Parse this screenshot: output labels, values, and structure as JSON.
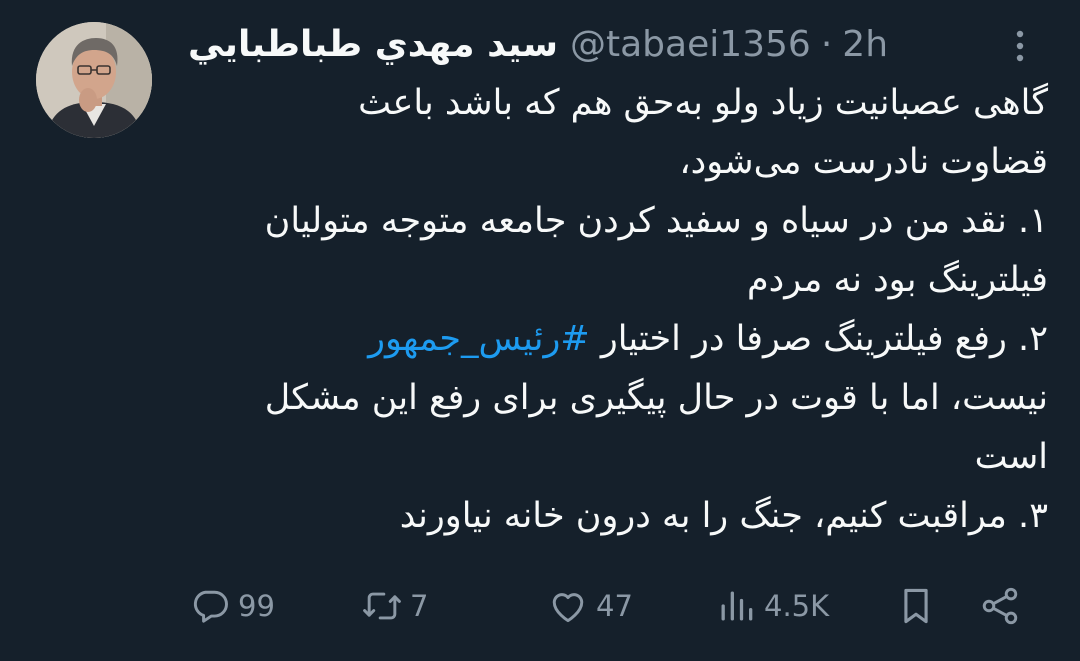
{
  "tweet": {
    "display_name": "سيد مهدي طباطبايي",
    "handle": "@tabaei1356",
    "separator": "·",
    "time": "2h",
    "avatar_icon": "profile-photo",
    "more_icon": "more-vertical-icon",
    "lines": [
      "گاهی عصبانیت زیاد ولو به‌حق هم که باشد باعث",
      "قضاوت نادرست می‌شود،",
      "۱. نقد من در سیاه و سفید کردن جامعه متوجه متولیان",
      "فیلترینگ بود نه مردم",
      "نیست، اما با قوت در حال پیگیری برای رفع این مشکل",
      "است",
      "۳. مراقبت کنیم، جنگ را به درون خانه نیاورند"
    ],
    "line_hashtag_prefix": "۲. رفع فیلترینگ صرفا در اختیار ",
    "hashtag": "#رئیس_جمهور"
  },
  "actions": {
    "reply_count": "99",
    "retweet_count": "7",
    "like_count": "47",
    "views_count": "4.5K",
    "icons": [
      "reply-icon",
      "retweet-icon",
      "like-icon",
      "views-icon",
      "bookmark-icon",
      "share-icon"
    ]
  },
  "colors": {
    "background": "#15202b",
    "text": "#f7f9f9",
    "secondary": "#8b98a5",
    "accent": "#1d9bf0"
  }
}
